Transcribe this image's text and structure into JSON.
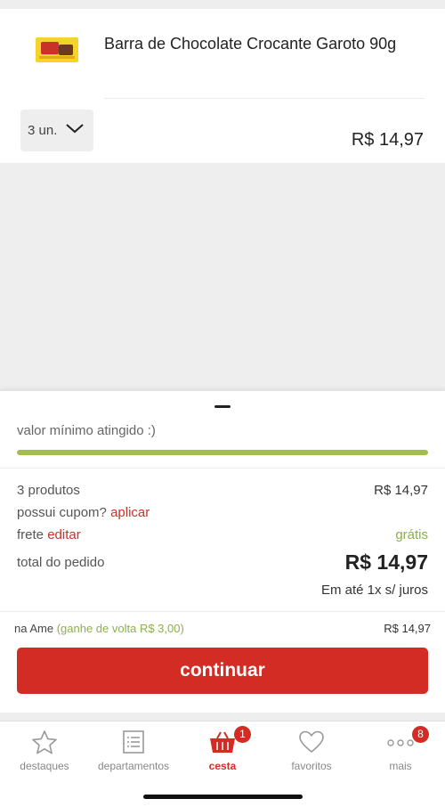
{
  "product": {
    "name": "Barra de Chocolate Crocante Garoto 90g",
    "image_brand": "Garoto",
    "quantity": "3 un.",
    "price": "R$ 14,97"
  },
  "sheet": {
    "min_value_text": "valor mínimo atingido :)",
    "progress": 1.0,
    "products_label": "3 produtos",
    "products_value": "R$ 14,97",
    "coupon_label": "possui cupom?",
    "coupon_link": "aplicar",
    "shipping_label": "frete",
    "shipping_link": "editar",
    "shipping_value": "grátis",
    "total_label": "total do pedido",
    "total_value": "R$ 14,97",
    "installments": "Em até 1x s/ juros",
    "ame_label": "na Ame",
    "ame_cashback": "(ganhe de volta R$ 3,00)",
    "ame_value": "R$ 14,97",
    "continue_label": "continuar"
  },
  "tabbar": {
    "items": [
      {
        "label": "destaques",
        "icon": "star-icon"
      },
      {
        "label": "departamentos",
        "icon": "list-icon"
      },
      {
        "label": "cesta",
        "icon": "basket-icon",
        "badge": "1",
        "active": true
      },
      {
        "label": "favoritos",
        "icon": "heart-icon"
      },
      {
        "label": "mais",
        "icon": "more-dots-icon",
        "badge": "8"
      }
    ]
  },
  "colors": {
    "accent": "#d22c24",
    "success": "#8bb04a",
    "progress": "#a3bd4d"
  }
}
